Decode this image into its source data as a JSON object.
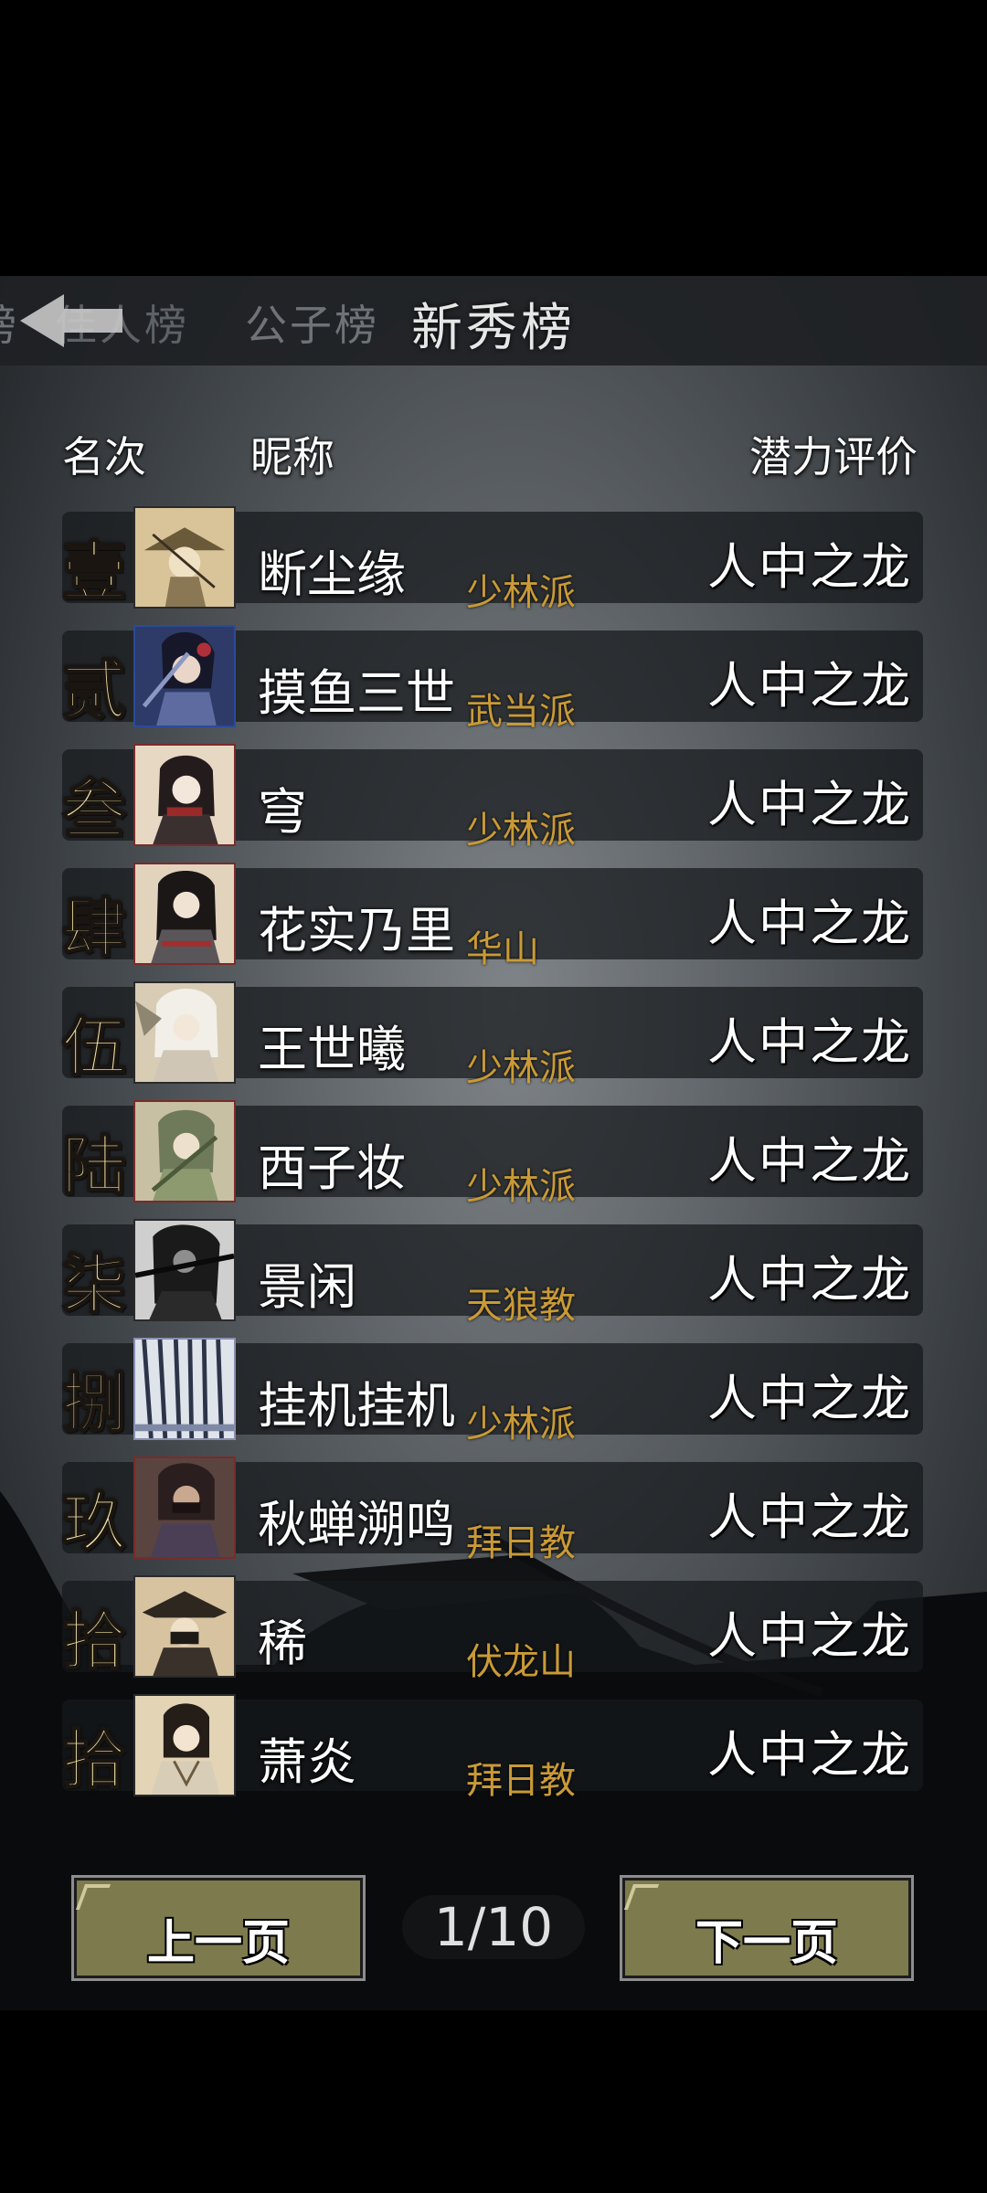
{
  "tabs": {
    "prev_partial": "榜",
    "tab1": "佳人榜",
    "tab2": "公子榜",
    "active": "新秀榜"
  },
  "columns": {
    "rank": "名次",
    "nickname": "昵称",
    "potential": "潜力评价"
  },
  "rows": [
    {
      "rank": "壹",
      "nickname": "断尘缘",
      "sect": "少林派",
      "potential": "人中之龙",
      "avatar_icon": "straw-hat-swordsman-avatar"
    },
    {
      "rank": "贰",
      "nickname": "摸鱼三世",
      "sect": "武当派",
      "potential": "人中之龙",
      "avatar_icon": "female-warrior-blue-avatar"
    },
    {
      "rank": "叁",
      "nickname": "穹",
      "sect": "少林派",
      "potential": "人中之龙",
      "avatar_icon": "female-hairpin-avatar"
    },
    {
      "rank": "肆",
      "nickname": "花实乃里",
      "sect": "华山",
      "potential": "人中之龙",
      "avatar_icon": "female-armored-avatar"
    },
    {
      "rank": "伍",
      "nickname": "王世曦",
      "sect": "少林派",
      "potential": "人中之龙",
      "avatar_icon": "white-hair-female-avatar"
    },
    {
      "rank": "陆",
      "nickname": "西子妆",
      "sect": "少林派",
      "potential": "人中之龙",
      "avatar_icon": "green-robe-female-avatar"
    },
    {
      "rank": "柒",
      "nickname": "景闲",
      "sect": "天狼教",
      "potential": "人中之龙",
      "avatar_icon": "ink-swordsman-avatar"
    },
    {
      "rank": "捌",
      "nickname": "挂机挂机",
      "sect": "少林派",
      "potential": "人中之龙",
      "avatar_icon": "ink-curtain-avatar"
    },
    {
      "rank": "玖",
      "nickname": "秋蝉溯鸣",
      "sect": "拜日教",
      "potential": "人中之龙",
      "avatar_icon": "masked-assassin-avatar"
    },
    {
      "rank": "拾",
      "nickname": "稀",
      "sect": "伏龙山",
      "potential": "人中之龙",
      "avatar_icon": "hat-masked-avatar"
    },
    {
      "rank": "拾",
      "nickname": "萧炎",
      "sect": "拜日教",
      "potential": "人中之龙",
      "avatar_icon": "scholar-male-avatar"
    }
  ],
  "pagination": {
    "prev_label": "上一页",
    "page": "1/10",
    "next_label": "下一页"
  },
  "colors": {
    "rank_text": "#f0e2a4",
    "sect_text": "#c99a36",
    "button_fill": "#7d7a4d"
  }
}
